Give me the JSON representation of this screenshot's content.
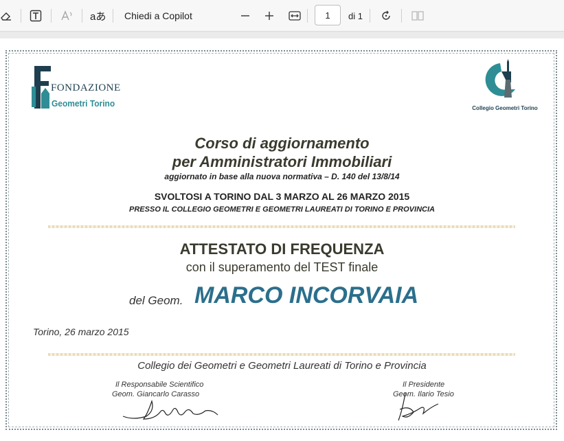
{
  "toolbar": {
    "copilot_label": "Chiedi a Copilot",
    "page_current": "1",
    "page_total": "di 1",
    "icons": [
      "eraser-icon",
      "text-box-icon",
      "read-aloud-icon",
      "translate-icon",
      "zoom-out-icon",
      "zoom-in-icon",
      "fit-width-icon",
      "rotate-icon",
      "page-view-icon"
    ]
  },
  "logos": {
    "left_line1": "FONDAZIONE",
    "left_line2": "Geometri Torino",
    "right_caption": "Collegio Geometri Torino"
  },
  "certificate": {
    "title_line1": "Corso di aggiornamento",
    "title_line2": "per Amministratori Immobiliari",
    "subtitle": "aggiornato in base alla nuova normativa – D. 140 del 13/8/14",
    "dates": "SVOLTOSI A TORINO DAL 3 MARZO AL 26 MARZO 2015",
    "place": "PRESSO IL COLLEGIO GEOMETRI E GEOMETRI LAUREATI DI TORINO E PROVINCIA",
    "heading": "ATTESTATO DI FREQUENZA",
    "heading_sub": "con il superamento del TEST finale",
    "recipient_prefix": "del Geom.",
    "recipient_name": "MARCO INCORVAIA",
    "date_line": "Torino, 26 marzo 2015",
    "issuer": "Collegio dei Geometri e Geometri Laureati di Torino e Provincia",
    "left_role": "Il Responsabile Scientifico",
    "left_name": "Geom. Giancarlo Carasso",
    "right_role": "Il Presidente",
    "right_name": "Geom. Ilario Tesio"
  },
  "colors": {
    "name_blue": "#2b6f8c",
    "logo_teal": "#2f8d95",
    "logo_dark": "#1e3f4f",
    "text_dark": "#3a3a2e"
  }
}
